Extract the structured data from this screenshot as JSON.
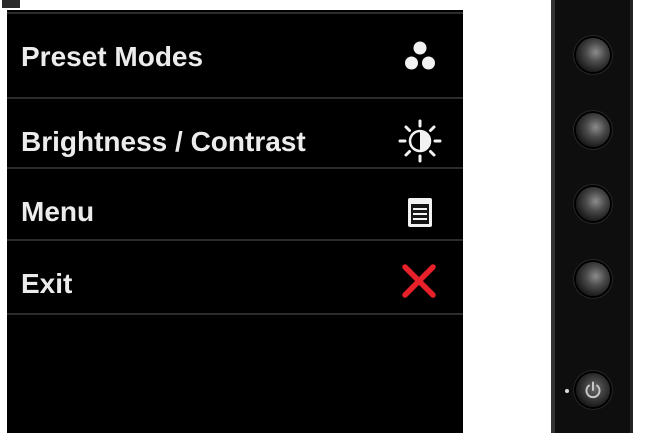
{
  "osd_menu": {
    "items": [
      {
        "label": "Preset Modes",
        "icon": "preset-modes-icon"
      },
      {
        "label": "Brightness / Contrast",
        "icon": "brightness-contrast-icon"
      },
      {
        "label": "Menu",
        "icon": "menu-icon"
      },
      {
        "label": "Exit",
        "icon": "exit-icon"
      }
    ]
  },
  "hardware": {
    "buttons": [
      "button-1",
      "button-2",
      "button-3",
      "button-4"
    ],
    "power_icon": "power-icon"
  },
  "colors": {
    "panel_background": "#000000",
    "label_text": "#ececec",
    "exit_icon": "#e8202a",
    "separator": "#2c2c2c"
  }
}
